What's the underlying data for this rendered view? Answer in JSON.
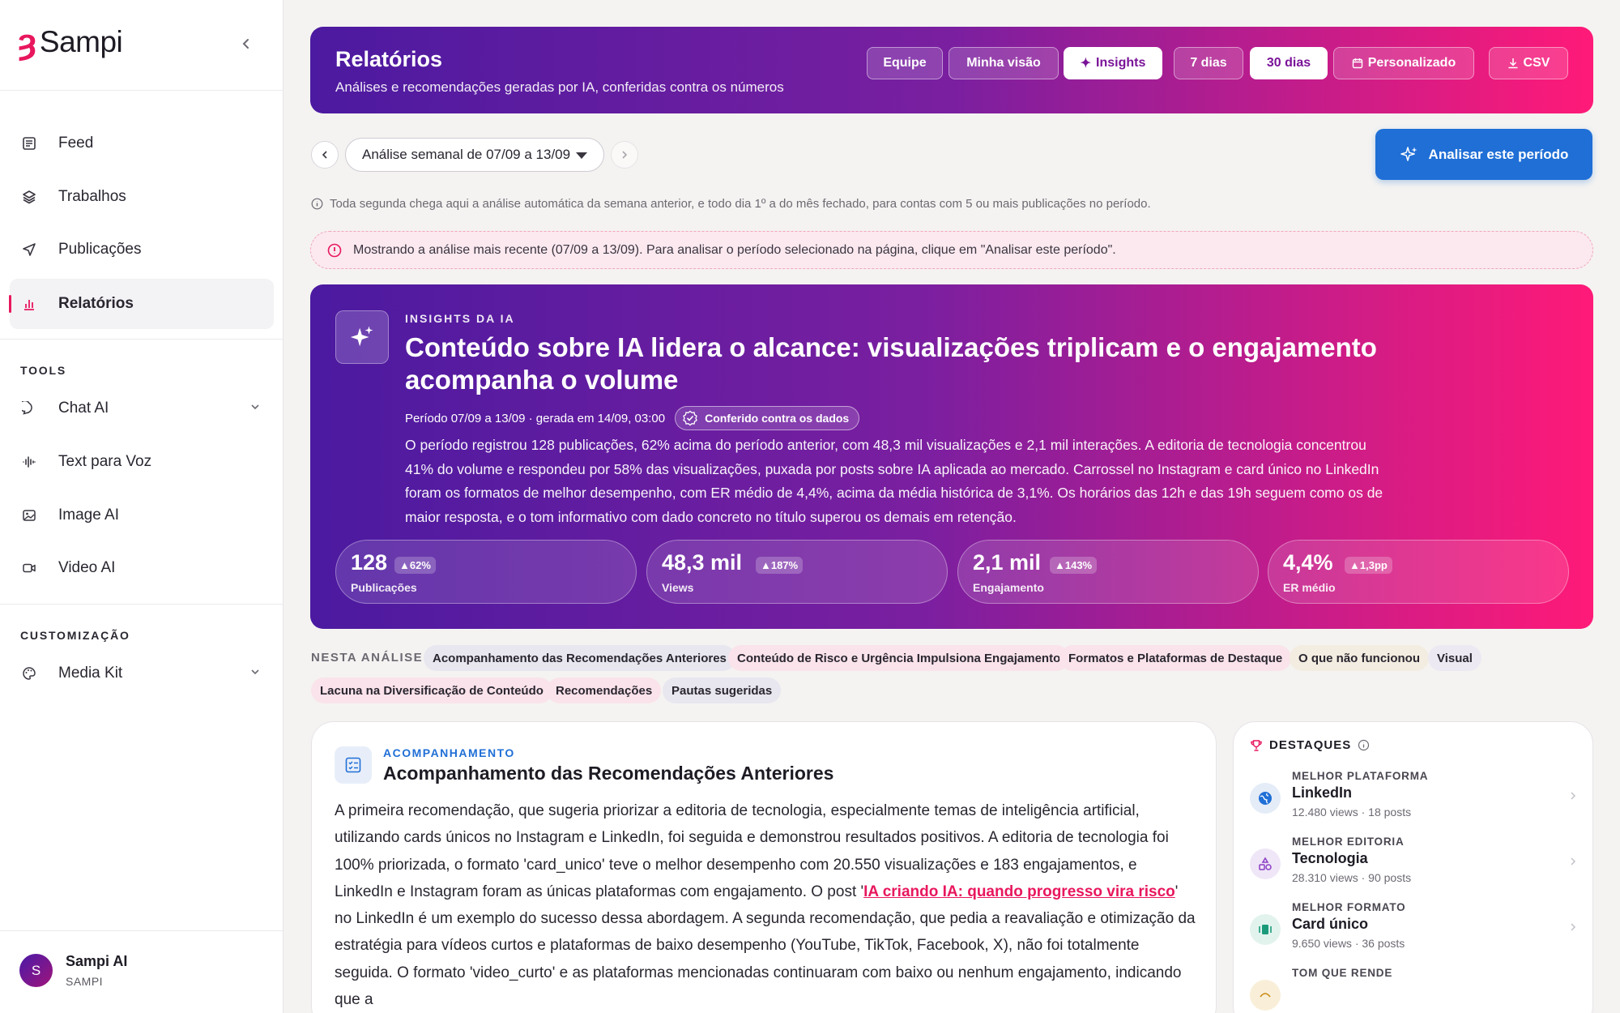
{
  "sidebar": {
    "brand": "Sampi",
    "items": [
      {
        "label": "Feed"
      },
      {
        "label": "Trabalhos"
      },
      {
        "label": "Publicações"
      },
      {
        "label": "Relatórios"
      }
    ],
    "tools_title": "TOOLS",
    "tools": [
      {
        "label": "Chat AI"
      },
      {
        "label": "Text para Voz"
      },
      {
        "label": "Image AI"
      },
      {
        "label": "Video AI"
      }
    ],
    "custom_title": "CUSTOMIZAÇÃO",
    "custom": [
      {
        "label": "Media Kit"
      }
    ],
    "user": {
      "initial": "S",
      "name": "Sampi AI",
      "org": "SAMPI"
    }
  },
  "header": {
    "title": "Relatórios",
    "subtitle": "Análises e recomendações geradas por IA, conferidas contra os números",
    "view_buttons": [
      "Equipe",
      "Minha visão",
      "Insights"
    ],
    "range_buttons": [
      "7 dias",
      "30 dias",
      "Personalizado"
    ],
    "export": "CSV"
  },
  "period": {
    "selected": "Análise semanal de 07/09 a 13/09",
    "analyze_button": "Analisar este período",
    "info": "Toda segunda chega aqui a análise automática da semana anterior, e todo dia 1º a do mês fechado, para contas com 5 ou mais publicações no período.",
    "notice": "Mostrando a análise mais recente (07/09 a 13/09). Para analisar o período selecionado na página, clique em \"Analisar este período\"."
  },
  "insight": {
    "kicker": "INSIGHTS DA IA",
    "title": "Conteúdo sobre IA lidera o alcance: visualizações triplicam e o engajamento acompanha o volume",
    "meta": "Período 07/09 a 13/09 · gerada em 14/09, 03:00",
    "verified": "Conferido contra os dados",
    "body": "O período registrou 128 publicações, 62% acima do período anterior, com 48,3 mil visualizações e 2,1 mil interações. A editoria de tecnologia concentrou 41% do volume e respondeu por 58% das visualizações, puxada por posts sobre IA aplicada ao mercado. Carrossel no Instagram e card único no LinkedIn foram os formatos de melhor desempenho, com ER médio de 4,4%, acima da média histórica de 3,1%. Os horários das 12h e das 19h seguem como os de maior resposta, e o tom informativo com dado concreto no título superou os demais em retenção.",
    "kpis": [
      {
        "value": "128",
        "delta": "▲62%",
        "label": "Publicações"
      },
      {
        "value": "48,3 mil",
        "delta": "▲187%",
        "label": "Views"
      },
      {
        "value": "2,1 mil",
        "delta": "▲143%",
        "label": "Engajamento"
      },
      {
        "value": "4,4%",
        "delta": "▲1,3pp",
        "label": "ER médio"
      }
    ]
  },
  "sections": {
    "label": "NESTA ANÁLISE",
    "chips": [
      "Acompanhamento das Recomendações Anteriores",
      "Conteúdo de Risco e Urgência Impulsiona Engajamento",
      "Formatos e Plataformas de Destaque",
      "O que não funcionou",
      "Visual",
      "Lacuna na Diversificação de Conteúdo",
      "Recomendações",
      "Pautas sugeridas"
    ]
  },
  "followup": {
    "kicker": "ACOMPANHAMENTO",
    "title": "Acompanhamento das Recomendações Anteriores",
    "text_before": "A primeira recomendação, que sugeria priorizar a editoria de tecnologia, especialmente temas de inteligência artificial, utilizando cards únicos no Instagram e LinkedIn, foi seguida e demonstrou resultados positivos. A editoria de tecnologia foi 100% priorizada, o formato 'card_unico' teve o melhor desempenho com 20.550 visualizações e 183 engajamentos, e LinkedIn e Instagram foram as únicas plataformas com engajamento. O post '",
    "link": "IA criando IA: quando progresso vira risco",
    "text_after": "' no LinkedIn é um exemplo do sucesso dessa abordagem. A segunda recomendação, que pedia a reavaliação e otimização da estratégia para vídeos curtos e plataformas de baixo desempenho (YouTube, TikTok, Facebook, X), não foi totalmente seguida. O formato 'video_curto' e as plataformas mencionadas continuaram com baixo ou nenhum engajamento, indicando que a"
  },
  "highlights": {
    "title": "DESTAQUES",
    "items": [
      {
        "kicker": "MELHOR PLATAFORMA",
        "name": "LinkedIn",
        "stats": "12.480 views · 18 posts",
        "icon": "globe-icon"
      },
      {
        "kicker": "MELHOR EDITORIA",
        "name": "Tecnologia",
        "stats": "28.310 views · 90 posts",
        "icon": "shapes-icon"
      },
      {
        "kicker": "MELHOR FORMATO",
        "name": "Card único",
        "stats": "9.650 views · 36 posts",
        "icon": "card-icon"
      },
      {
        "kicker": "TOM QUE RENDE",
        "name": "",
        "stats": "",
        "icon": "tone-icon"
      }
    ]
  },
  "colors": {
    "brand": "#e8175d",
    "accent_blue": "#1f6fd6",
    "gradient_start": "#4b1aa0",
    "gradient_end": "#ff1a78"
  }
}
